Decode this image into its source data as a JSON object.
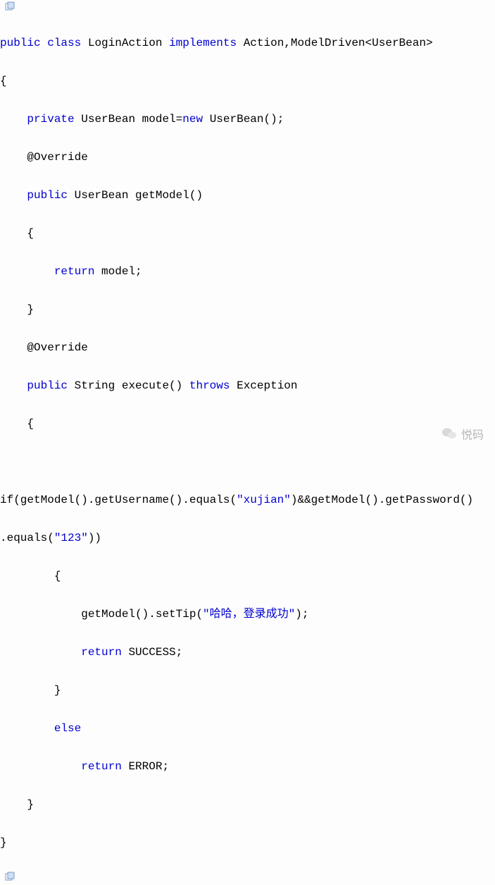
{
  "code": {
    "line1": {
      "kw1": "public",
      "kw2": "class",
      "name": "LoginAction",
      "kw3": "implements",
      "rest": "Action,ModelDriven<UserBean>"
    },
    "line2": "{",
    "line3": {
      "kw": "private",
      "type": "UserBean",
      "var": "model=",
      "kw2": "new",
      "rest": "UserBean();"
    },
    "line4": "@Override",
    "line5": {
      "kw": "public",
      "type": "UserBean",
      "method": "getModel()"
    },
    "line6": "{",
    "line7": {
      "kw": "return",
      "rest": "model;"
    },
    "line8": "}",
    "line9": "@Override",
    "line10": {
      "kw": "public",
      "type": "String",
      "method": "execute()",
      "kw2": "throws",
      "exc": "Exception"
    },
    "line11": "{",
    "line12a": "if(getModel().getUsername().equals(",
    "line12str1": "\"xujian\"",
    "line12b": ")&&getModel().getPassword()",
    "line13a": ".equals(",
    "line13str": "\"123\"",
    "line13b": "))",
    "line14": "{",
    "line15a": "getModel().setTip(",
    "line15str": "\"哈哈，登录成功\"",
    "line15b": ");",
    "line16": {
      "kw": "return",
      "rest": "SUCCESS;"
    },
    "line17": "}",
    "line18": {
      "kw": "else"
    },
    "line19": {
      "kw": "return",
      "rest": "ERROR;"
    },
    "line20": "}",
    "line21": "}"
  },
  "watermark": {
    "text": "悦码"
  }
}
